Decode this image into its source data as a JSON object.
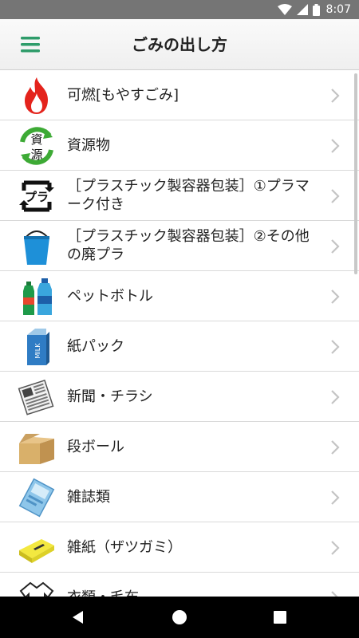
{
  "status_bar": {
    "time": "8:07"
  },
  "app_bar": {
    "title": "ごみの出し方",
    "menu_icon": "hamburger-menu-icon",
    "accent_color": "#2e9c6a"
  },
  "list_items": [
    {
      "label": "可燃[もやすごみ]",
      "icon": "flame-icon"
    },
    {
      "label": "資源物",
      "icon": "recycle-resources-icon",
      "icon_text": [
        "資",
        "源"
      ]
    },
    {
      "label": "［プラスチック製容器包装］①プラマーク付き",
      "icon": "pla-mark-icon",
      "icon_text": "プラ"
    },
    {
      "label": "［プラスチック製容器包装］②その他の廃プラ",
      "icon": "bucket-icon"
    },
    {
      "label": "ペットボトル",
      "icon": "pet-bottle-icon"
    },
    {
      "label": "紙パック",
      "icon": "milk-carton-icon",
      "icon_text": "MILK"
    },
    {
      "label": "新聞・チラシ",
      "icon": "newspaper-icon"
    },
    {
      "label": "段ボール",
      "icon": "cardboard-box-icon"
    },
    {
      "label": "雑誌類",
      "icon": "magazine-icon"
    },
    {
      "label": "雑紙（ザツガミ）",
      "icon": "mixed-paper-icon"
    },
    {
      "label": "衣類・毛布",
      "icon": "clothing-icon"
    }
  ]
}
